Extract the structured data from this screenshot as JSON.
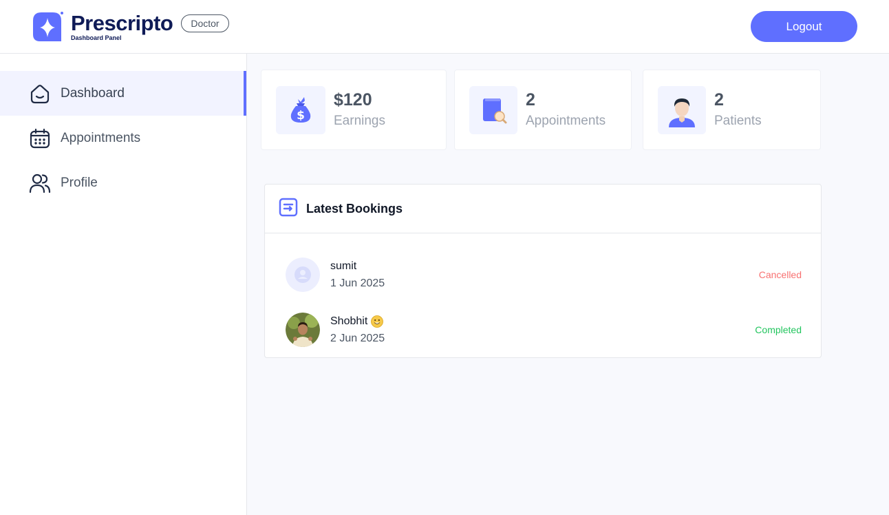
{
  "header": {
    "brand_name": "Prescripto",
    "brand_sub": "Dashboard Panel",
    "role_badge": "Doctor",
    "logout_label": "Logout"
  },
  "sidebar": {
    "items": [
      {
        "label": "Dashboard",
        "icon": "home-icon",
        "active": true
      },
      {
        "label": "Appointments",
        "icon": "calendar-icon",
        "active": false
      },
      {
        "label": "Profile",
        "icon": "people-icon",
        "active": false
      }
    ]
  },
  "stats": [
    {
      "value": "$120",
      "label": "Earnings",
      "icon": "money-bag-icon"
    },
    {
      "value": "2",
      "label": "Appointments",
      "icon": "appointment-book-icon"
    },
    {
      "value": "2",
      "label": "Patients",
      "icon": "patient-icon"
    }
  ],
  "bookings": {
    "title": "Latest Bookings",
    "rows": [
      {
        "name": "sumit",
        "date": "1 Jun 2025",
        "status": "Cancelled",
        "status_color": "#f87171"
      },
      {
        "name": "Shobhit",
        "date": "2 Jun 2025",
        "status": "Completed",
        "status_color": "#22c55e"
      }
    ]
  },
  "colors": {
    "accent": "#5f6fff",
    "brand_dark": "#0f1b57",
    "cancelled": "#f87171",
    "completed": "#22c55e"
  }
}
